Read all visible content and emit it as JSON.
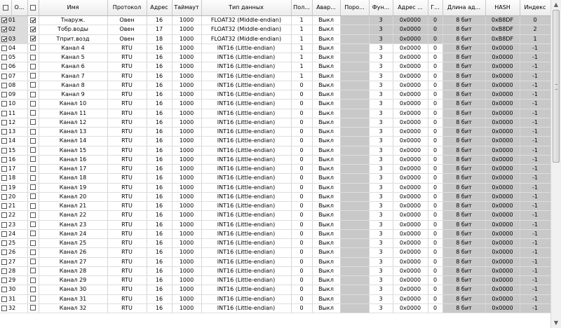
{
  "columns": [
    "",
    "О...",
    "",
    "Имя",
    "Протокол",
    "Адрес",
    "Таймаут",
    "Тип данных",
    "Пол...",
    "Авар...",
    "Поро...",
    "Фун...",
    "Адрес ...",
    "Г...",
    "Длина ад...",
    "HASH",
    "Индекс"
  ],
  "rows": [
    {
      "num": "01",
      "checked": true,
      "enabled": true,
      "name": "Тнаруж.",
      "proto": "Овен",
      "addr": "16",
      "timeout": "1000",
      "dtype": "FLOAT32 (Middle-endian)",
      "pol": "1",
      "alarm": "Выкл",
      "fn": "3",
      "addr2": "0x0000",
      "g": "0",
      "len": "8 бит",
      "hash": "0xB8DF",
      "idx": "0"
    },
    {
      "num": "02",
      "checked": true,
      "enabled": true,
      "name": "Тобр.воды",
      "proto": "Овен",
      "addr": "17",
      "timeout": "1000",
      "dtype": "FLOAT32 (Middle-endian)",
      "pol": "1",
      "alarm": "Выкл",
      "fn": "3",
      "addr2": "0x0000",
      "g": "0",
      "len": "8 бит",
      "hash": "0xB8DF",
      "idx": "2"
    },
    {
      "num": "03",
      "checked": true,
      "enabled": true,
      "name": "Тприт.возд",
      "proto": "Овен",
      "addr": "18",
      "timeout": "1000",
      "dtype": "FLOAT32 (Middle-endian)",
      "pol": "1",
      "alarm": "Выкл",
      "fn": "3",
      "addr2": "0x0000",
      "g": "0",
      "len": "8 бит",
      "hash": "0xB8DF",
      "idx": "1"
    },
    {
      "num": "04",
      "checked": false,
      "enabled": false,
      "name": "Канал 4",
      "proto": "RTU",
      "addr": "16",
      "timeout": "1000",
      "dtype": "INT16 (Little-endian)",
      "pol": "1",
      "alarm": "Выкл",
      "fn": "3",
      "addr2": "0x0000",
      "g": "0",
      "len": "8 бит",
      "hash": "0x0000",
      "idx": "-1"
    },
    {
      "num": "05",
      "checked": false,
      "enabled": false,
      "name": "Канал 5",
      "proto": "RTU",
      "addr": "16",
      "timeout": "1000",
      "dtype": "INT16 (Little-endian)",
      "pol": "1",
      "alarm": "Выкл",
      "fn": "3",
      "addr2": "0x0000",
      "g": "0",
      "len": "8 бит",
      "hash": "0x0000",
      "idx": "-1"
    },
    {
      "num": "06",
      "checked": false,
      "enabled": false,
      "name": "Канал 6",
      "proto": "RTU",
      "addr": "16",
      "timeout": "1000",
      "dtype": "INT16 (Little-endian)",
      "pol": "1",
      "alarm": "Выкл",
      "fn": "3",
      "addr2": "0x0000",
      "g": "0",
      "len": "8 бит",
      "hash": "0x0000",
      "idx": "-1"
    },
    {
      "num": "07",
      "checked": false,
      "enabled": false,
      "name": "Канал 7",
      "proto": "RTU",
      "addr": "16",
      "timeout": "1000",
      "dtype": "INT16 (Little-endian)",
      "pol": "1",
      "alarm": "Выкл",
      "fn": "3",
      "addr2": "0x0000",
      "g": "0",
      "len": "8 бит",
      "hash": "0x0000",
      "idx": "-1"
    },
    {
      "num": "08",
      "checked": false,
      "enabled": false,
      "name": "Канал 8",
      "proto": "RTU",
      "addr": "16",
      "timeout": "1000",
      "dtype": "INT16 (Little-endian)",
      "pol": "0",
      "alarm": "Выкл",
      "fn": "3",
      "addr2": "0x0000",
      "g": "0",
      "len": "8 бит",
      "hash": "0x0000",
      "idx": "-1"
    },
    {
      "num": "09",
      "checked": false,
      "enabled": false,
      "name": "Канал 9",
      "proto": "RTU",
      "addr": "16",
      "timeout": "1000",
      "dtype": "INT16 (Little-endian)",
      "pol": "0",
      "alarm": "Выкл",
      "fn": "3",
      "addr2": "0x0000",
      "g": "0",
      "len": "8 бит",
      "hash": "0x0000",
      "idx": "-1"
    },
    {
      "num": "10",
      "checked": false,
      "enabled": false,
      "name": "Канал 10",
      "proto": "RTU",
      "addr": "16",
      "timeout": "1000",
      "dtype": "INT16 (Little-endian)",
      "pol": "0",
      "alarm": "Выкл",
      "fn": "3",
      "addr2": "0x0000",
      "g": "0",
      "len": "8 бит",
      "hash": "0x0000",
      "idx": "-1"
    },
    {
      "num": "11",
      "checked": false,
      "enabled": false,
      "name": "Канал 11",
      "proto": "RTU",
      "addr": "16",
      "timeout": "1000",
      "dtype": "INT16 (Little-endian)",
      "pol": "0",
      "alarm": "Выкл",
      "fn": "3",
      "addr2": "0x0000",
      "g": "0",
      "len": "8 бит",
      "hash": "0x0000",
      "idx": "-1"
    },
    {
      "num": "12",
      "checked": false,
      "enabled": false,
      "name": "Канал 12",
      "proto": "RTU",
      "addr": "16",
      "timeout": "1000",
      "dtype": "INT16 (Little-endian)",
      "pol": "0",
      "alarm": "Выкл",
      "fn": "3",
      "addr2": "0x0000",
      "g": "0",
      "len": "8 бит",
      "hash": "0x0000",
      "idx": "-1"
    },
    {
      "num": "13",
      "checked": false,
      "enabled": false,
      "name": "Канал 13",
      "proto": "RTU",
      "addr": "16",
      "timeout": "1000",
      "dtype": "INT16 (Little-endian)",
      "pol": "0",
      "alarm": "Выкл",
      "fn": "3",
      "addr2": "0x0000",
      "g": "0",
      "len": "8 бит",
      "hash": "0x0000",
      "idx": "-1"
    },
    {
      "num": "14",
      "checked": false,
      "enabled": false,
      "name": "Канал 14",
      "proto": "RTU",
      "addr": "16",
      "timeout": "1000",
      "dtype": "INT16 (Little-endian)",
      "pol": "0",
      "alarm": "Выкл",
      "fn": "3",
      "addr2": "0x0000",
      "g": "0",
      "len": "8 бит",
      "hash": "0x0000",
      "idx": "-1"
    },
    {
      "num": "15",
      "checked": false,
      "enabled": false,
      "name": "Канал 15",
      "proto": "RTU",
      "addr": "16",
      "timeout": "1000",
      "dtype": "INT16 (Little-endian)",
      "pol": "0",
      "alarm": "Выкл",
      "fn": "3",
      "addr2": "0x0000",
      "g": "0",
      "len": "8 бит",
      "hash": "0x0000",
      "idx": "-1"
    },
    {
      "num": "16",
      "checked": false,
      "enabled": false,
      "name": "Канал 16",
      "proto": "RTU",
      "addr": "16",
      "timeout": "1000",
      "dtype": "INT16 (Little-endian)",
      "pol": "0",
      "alarm": "Выкл",
      "fn": "3",
      "addr2": "0x0000",
      "g": "0",
      "len": "8 бит",
      "hash": "0x0000",
      "idx": "-1"
    },
    {
      "num": "17",
      "checked": false,
      "enabled": false,
      "name": "Канал 17",
      "proto": "RTU",
      "addr": "16",
      "timeout": "1000",
      "dtype": "INT16 (Little-endian)",
      "pol": "0",
      "alarm": "Выкл",
      "fn": "3",
      "addr2": "0x0000",
      "g": "0",
      "len": "8 бит",
      "hash": "0x0000",
      "idx": "-1"
    },
    {
      "num": "18",
      "checked": false,
      "enabled": false,
      "name": "Канал 18",
      "proto": "RTU",
      "addr": "16",
      "timeout": "1000",
      "dtype": "INT16 (Little-endian)",
      "pol": "0",
      "alarm": "Выкл",
      "fn": "3",
      "addr2": "0x0000",
      "g": "0",
      "len": "8 бит",
      "hash": "0x0000",
      "idx": "-1"
    },
    {
      "num": "19",
      "checked": false,
      "enabled": false,
      "name": "Канал 19",
      "proto": "RTU",
      "addr": "16",
      "timeout": "1000",
      "dtype": "INT16 (Little-endian)",
      "pol": "0",
      "alarm": "Выкл",
      "fn": "3",
      "addr2": "0x0000",
      "g": "0",
      "len": "8 бит",
      "hash": "0x0000",
      "idx": "-1"
    },
    {
      "num": "20",
      "checked": false,
      "enabled": false,
      "name": "Канал 20",
      "proto": "RTU",
      "addr": "16",
      "timeout": "1000",
      "dtype": "INT16 (Little-endian)",
      "pol": "0",
      "alarm": "Выкл",
      "fn": "3",
      "addr2": "0x0000",
      "g": "0",
      "len": "8 бит",
      "hash": "0x0000",
      "idx": "-1"
    },
    {
      "num": "21",
      "checked": false,
      "enabled": false,
      "name": "Канал 21",
      "proto": "RTU",
      "addr": "16",
      "timeout": "1000",
      "dtype": "INT16 (Little-endian)",
      "pol": "0",
      "alarm": "Выкл",
      "fn": "3",
      "addr2": "0x0000",
      "g": "0",
      "len": "8 бит",
      "hash": "0x0000",
      "idx": "-1"
    },
    {
      "num": "22",
      "checked": false,
      "enabled": false,
      "name": "Канал 22",
      "proto": "RTU",
      "addr": "16",
      "timeout": "1000",
      "dtype": "INT16 (Little-endian)",
      "pol": "0",
      "alarm": "Выкл",
      "fn": "3",
      "addr2": "0x0000",
      "g": "0",
      "len": "8 бит",
      "hash": "0x0000",
      "idx": "-1"
    },
    {
      "num": "23",
      "checked": false,
      "enabled": false,
      "name": "Канал 23",
      "proto": "RTU",
      "addr": "16",
      "timeout": "1000",
      "dtype": "INT16 (Little-endian)",
      "pol": "0",
      "alarm": "Выкл",
      "fn": "3",
      "addr2": "0x0000",
      "g": "0",
      "len": "8 бит",
      "hash": "0x0000",
      "idx": "-1"
    },
    {
      "num": "24",
      "checked": false,
      "enabled": false,
      "name": "Канал 24",
      "proto": "RTU",
      "addr": "16",
      "timeout": "1000",
      "dtype": "INT16 (Little-endian)",
      "pol": "0",
      "alarm": "Выкл",
      "fn": "3",
      "addr2": "0x0000",
      "g": "0",
      "len": "8 бит",
      "hash": "0x0000",
      "idx": "-1"
    },
    {
      "num": "25",
      "checked": false,
      "enabled": false,
      "name": "Канал 25",
      "proto": "RTU",
      "addr": "16",
      "timeout": "1000",
      "dtype": "INT16 (Little-endian)",
      "pol": "0",
      "alarm": "Выкл",
      "fn": "3",
      "addr2": "0x0000",
      "g": "0",
      "len": "8 бит",
      "hash": "0x0000",
      "idx": "-1"
    },
    {
      "num": "26",
      "checked": false,
      "enabled": false,
      "name": "Канал 26",
      "proto": "RTU",
      "addr": "16",
      "timeout": "1000",
      "dtype": "INT16 (Little-endian)",
      "pol": "0",
      "alarm": "Выкл",
      "fn": "3",
      "addr2": "0x0000",
      "g": "0",
      "len": "8 бит",
      "hash": "0x0000",
      "idx": "-1"
    },
    {
      "num": "27",
      "checked": false,
      "enabled": false,
      "name": "Канал 27",
      "proto": "RTU",
      "addr": "16",
      "timeout": "1000",
      "dtype": "INT16 (Little-endian)",
      "pol": "0",
      "alarm": "Выкл",
      "fn": "3",
      "addr2": "0x0000",
      "g": "0",
      "len": "8 бит",
      "hash": "0x0000",
      "idx": "-1"
    },
    {
      "num": "28",
      "checked": false,
      "enabled": false,
      "name": "Канал 28",
      "proto": "RTU",
      "addr": "16",
      "timeout": "1000",
      "dtype": "INT16 (Little-endian)",
      "pol": "0",
      "alarm": "Выкл",
      "fn": "3",
      "addr2": "0x0000",
      "g": "0",
      "len": "8 бит",
      "hash": "0x0000",
      "idx": "-1"
    },
    {
      "num": "29",
      "checked": false,
      "enabled": false,
      "name": "Канал 29",
      "proto": "RTU",
      "addr": "16",
      "timeout": "1000",
      "dtype": "INT16 (Little-endian)",
      "pol": "0",
      "alarm": "Выкл",
      "fn": "3",
      "addr2": "0x0000",
      "g": "0",
      "len": "8 бит",
      "hash": "0x0000",
      "idx": "-1"
    },
    {
      "num": "30",
      "checked": false,
      "enabled": false,
      "name": "Канал 30",
      "proto": "RTU",
      "addr": "16",
      "timeout": "1000",
      "dtype": "INT16 (Little-endian)",
      "pol": "0",
      "alarm": "Выкл",
      "fn": "3",
      "addr2": "0x0000",
      "g": "0",
      "len": "8 бит",
      "hash": "0x0000",
      "idx": "-1"
    },
    {
      "num": "31",
      "checked": false,
      "enabled": false,
      "name": "Канал 31",
      "proto": "RTU",
      "addr": "16",
      "timeout": "1000",
      "dtype": "INT16 (Little-endian)",
      "pol": "0",
      "alarm": "Выкл",
      "fn": "3",
      "addr2": "0x0000",
      "g": "0",
      "len": "8 бит",
      "hash": "0x0000",
      "idx": "-1"
    },
    {
      "num": "32",
      "checked": false,
      "enabled": false,
      "name": "Канал 32",
      "proto": "RTU",
      "addr": "16",
      "timeout": "1000",
      "dtype": "INT16 (Little-endian)",
      "pol": "0",
      "alarm": "Выкл",
      "fn": "3",
      "addr2": "0x0000",
      "g": "0",
      "len": "8 бит",
      "hash": "0x0000",
      "idx": "-1"
    }
  ],
  "scrollbar": {
    "up_icon": "triangle-up-icon",
    "down_icon": "triangle-down-icon"
  },
  "colors": {
    "gray_cell": "#c8c8c8",
    "selected_num": "#dcdcdc",
    "header": "#ececec"
  }
}
